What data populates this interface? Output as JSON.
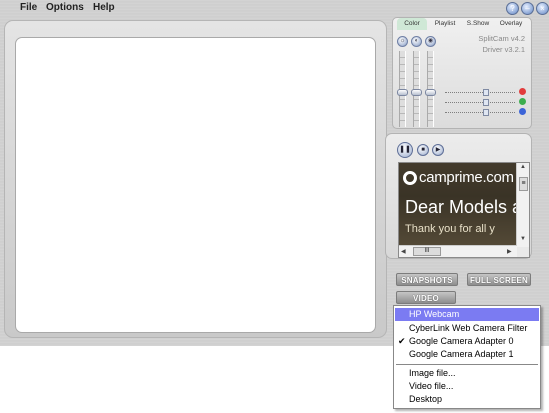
{
  "menu": {
    "items": [
      "File",
      "Options",
      "Help"
    ]
  },
  "window_controls": {
    "help": "?",
    "minimize": "–",
    "close": "×"
  },
  "settings": {
    "tabs": [
      "Color",
      "Playlist",
      "S.Show",
      "Overlay"
    ],
    "active_tab": "Color",
    "version_app": "SplitCam v4.2",
    "version_driver": "Driver v3.2.1",
    "color_channels": [
      "red",
      "green",
      "blue"
    ],
    "colors": {
      "red": "#e23c3c",
      "green": "#3cae4e",
      "blue": "#3c64d8"
    }
  },
  "player": {
    "controls": [
      "pause",
      "stop",
      "play"
    ],
    "ad_logo": "camprime.com",
    "ad_headline": "Dear Models a",
    "ad_subline": "Thank you for all y",
    "scroll_h_thumb": "III",
    "scroll_v_thumb": "≡"
  },
  "buttons": {
    "snapshots": "SNAPSHOTS",
    "fullscreen": "FULL SCREEN",
    "video": "VIDEO"
  },
  "video_sources": {
    "items": [
      {
        "label": "HP Webcam",
        "selected": true,
        "checked": false
      },
      {
        "label": "CyberLink Web Camera Filter",
        "selected": false,
        "checked": false
      },
      {
        "label": "Google Camera Adapter 0",
        "selected": false,
        "checked": true
      },
      {
        "label": "Google Camera Adapter 1",
        "selected": false,
        "checked": false
      }
    ],
    "file_items": [
      "Image file...",
      "Video file...",
      "Desktop"
    ],
    "check_mark": "✔"
  }
}
